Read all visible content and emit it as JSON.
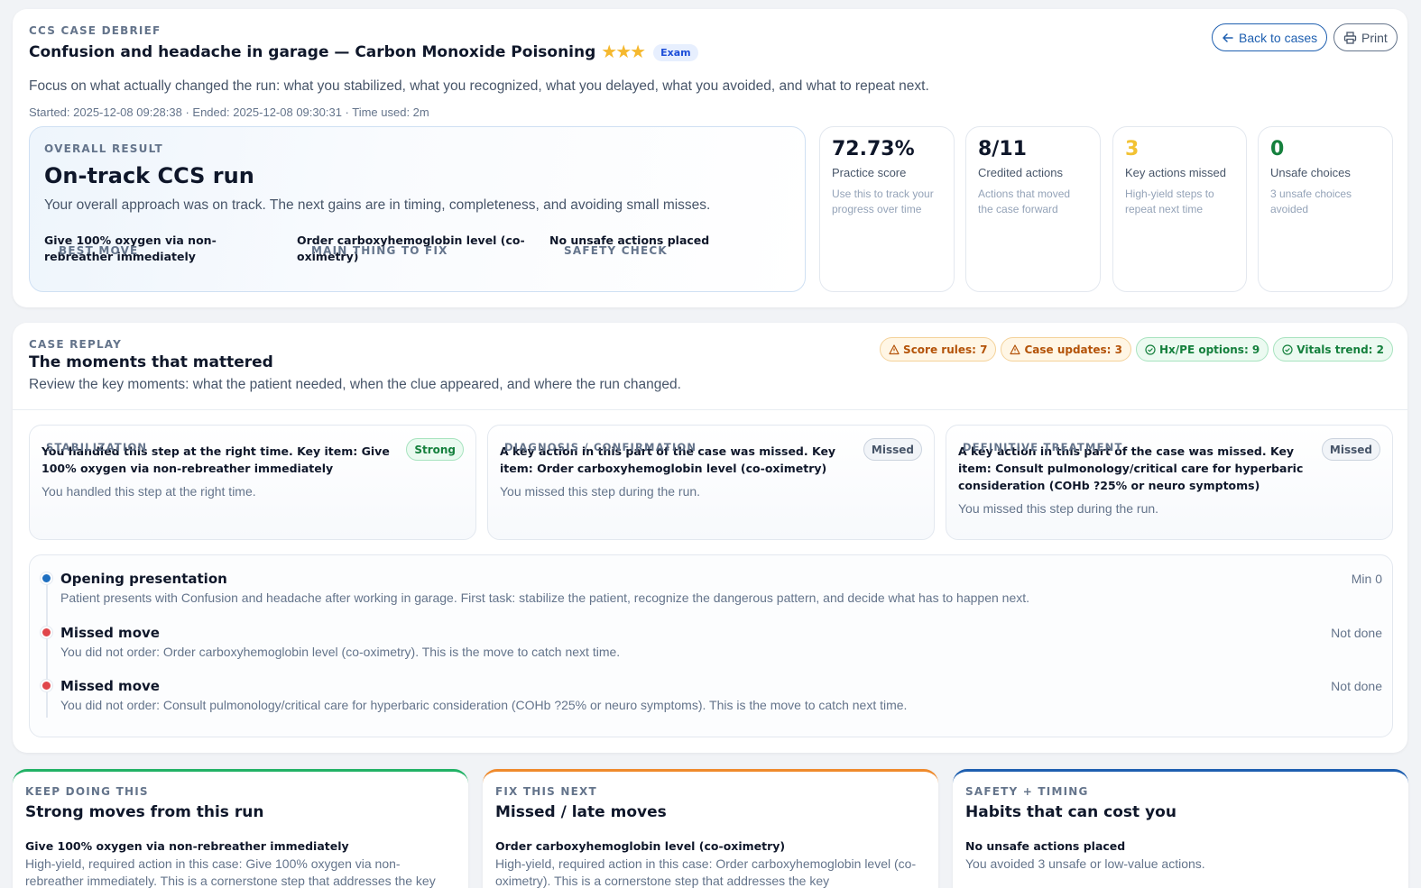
{
  "header": {
    "eyebrow": "CCS CASE DEBRIEF",
    "title": "Confusion and headache in garage — Carbon Monoxide Poisoning",
    "stars": "★★★",
    "mode_badge": "Exam",
    "lead": "Focus on what actually changed the run: what you stabilized, what you recognized, what you delayed, what you avoided, and what to repeat next.",
    "meta": "Started: 2025-12-08 09:28:38 · Ended: 2025-12-08 09:30:31 · Time used: 2m",
    "back_label": "Back to cases",
    "print_label": "Print"
  },
  "overall": {
    "eyebrow": "OVERALL RESULT",
    "headline": "On-track CCS run",
    "summary": "Your overall approach was on track. The next gains are in timing, completeness, and avoiding small misses.",
    "best_move_label": "BEST MOVE",
    "best_move": "Give 100% oxygen via non-rebreather immediately",
    "fix_label": "MAIN THING TO FIX",
    "fix": "Order carboxyhemoglobin level (co-oximetry)",
    "safety_label": "SAFETY CHECK",
    "safety": "No unsafe actions placed"
  },
  "stats": [
    {
      "value": "72.73%",
      "label": "Practice score",
      "desc": "Use this to track your progress over time",
      "color": "#0f172a"
    },
    {
      "value": "8/11",
      "label": "Credited actions",
      "desc": "Actions that moved the case forward",
      "color": "#0f172a"
    },
    {
      "value": "3",
      "label": "Key actions missed",
      "desc": "High-yield steps to repeat next time",
      "color": "#f2c233"
    },
    {
      "value": "0",
      "label": "Unsafe choices",
      "desc": "3 unsafe choices avoided",
      "color": "#15803d"
    }
  ],
  "replay": {
    "eyebrow": "CASE REPLAY",
    "title": "The moments that mattered",
    "lead": "Review the key moments: what the patient needed, when the clue appeared, and where the run changed.",
    "chips": [
      {
        "label": "Score rules: 7",
        "kind": "warn"
      },
      {
        "label": "Case updates: 3",
        "kind": "warn"
      },
      {
        "label": "Hx/PE options: 9",
        "kind": "ok"
      },
      {
        "label": "Vitals trend: 2",
        "kind": "ok"
      }
    ],
    "phases": [
      {
        "eyebrow": "STABILIZATION",
        "badge": "Strong",
        "key": "You handled this step at the right time. Key item: Give 100% oxygen via non-rebreather immediately",
        "note": "You handled this step at the right time."
      },
      {
        "eyebrow": "DIAGNOSIS / CONFIRMATION",
        "badge": "Missed",
        "key": "A key action in this part of the case was missed. Key item: Order carboxyhemoglobin level (co-oximetry)",
        "note": "You missed this step during the run."
      },
      {
        "eyebrow": "DEFINITIVE TREATMENT",
        "badge": "Missed",
        "key": "A key action in this part of the case was missed. Key item: Consult pulmonology/critical care for hyperbaric consideration (COHb ?25% or neuro symptoms)",
        "note": "You missed this step during the run."
      }
    ],
    "timeline": [
      {
        "title": "Opening presentation",
        "desc": "Patient presents with Confusion and headache after working in garage. First task: stabilize the patient, recognize the dangerous pattern, and decide what has to happen next.",
        "when": "Min 0",
        "color": "#1e6fc0"
      },
      {
        "title": "Missed move",
        "desc": "You did not order: Order carboxyhemoglobin level (co-oximetry). This is the move to catch next time.",
        "when": "Not done",
        "color": "#e0464b"
      },
      {
        "title": "Missed move",
        "desc": "You did not order: Consult pulmonology/critical care for hyperbaric consideration (COHb ?25% or neuro symptoms). This is the move to catch next time.",
        "when": "Not done",
        "color": "#e0464b"
      }
    ]
  },
  "bottom": [
    {
      "eyebrow": "KEEP DOING THIS",
      "title": "Strong moves from this run",
      "item": "Give 100% oxygen via non-rebreather immediately",
      "text": "High-yield, required action in this case: Give 100% oxygen via non-rebreather immediately. This is a cornerstone step that addresses the key",
      "accent": "#22b266"
    },
    {
      "eyebrow": "FIX THIS NEXT",
      "title": "Missed / late moves",
      "item": "Order carboxyhemoglobin level (co-oximetry)",
      "text": "High-yield, required action in this case: Order carboxyhemoglobin level (co-oximetry). This is a cornerstone step that addresses the key",
      "accent": "#ef8a2c"
    },
    {
      "eyebrow": "SAFETY + TIMING",
      "title": "Habits that can cost you",
      "item": "No unsafe actions placed",
      "text": "You avoided 3 unsafe or low-value actions.",
      "accent": "#1e5fb0"
    }
  ]
}
